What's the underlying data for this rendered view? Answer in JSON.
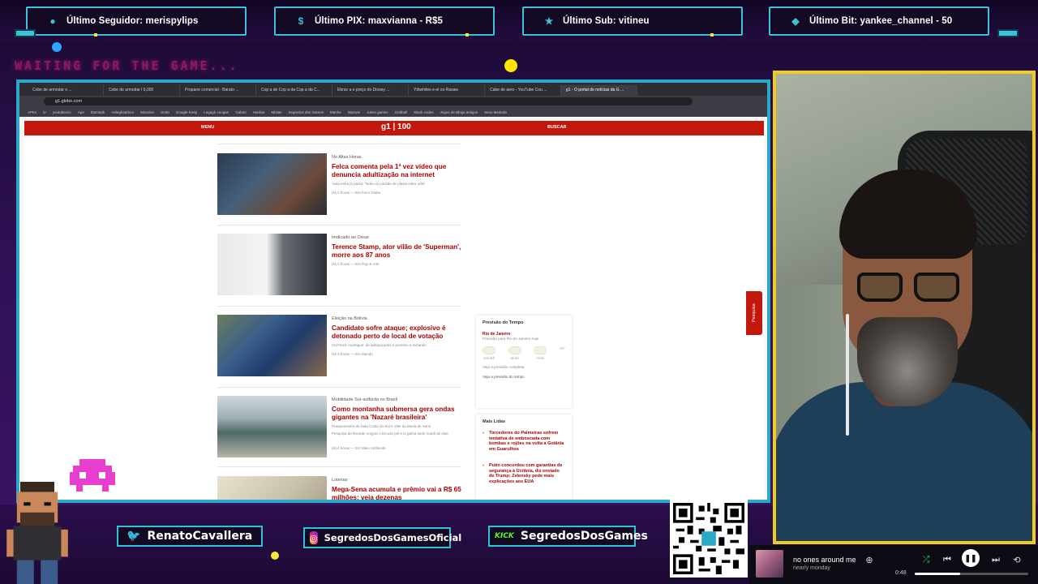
{
  "alerts": [
    {
      "icon": "user-icon",
      "text": "Último Seguidor: merispylips"
    },
    {
      "icon": "dollar-icon",
      "text": "Último PIX: maxvianna - R$5"
    },
    {
      "icon": "star-icon",
      "text": "Último Sub: vitineu"
    },
    {
      "icon": "diamond-icon",
      "text": "Último Bit: yankee_channel - 50"
    }
  ],
  "overlay": {
    "waiting_text": "WAITING FOR THE GAME..."
  },
  "browser": {
    "tabs": [
      "Cobe de armodar o ...",
      "Cobe de armodar l 5,000",
      "Propane comercial - Barato ...",
      "Cop a de Cop a da Cop a da C...",
      "Ebrav a e preço do Disney ...",
      "Ytbwhites e-el oo Rasaw",
      "Cabe de aero - YouTube Cou ...",
      "g1 - O portal de notícias da G ..."
    ],
    "active_tab": 7,
    "url": "g1.globo.com",
    "bookmarks": [
      "APKs",
      "tv",
      "youtubecnc",
      "Ape",
      "tttamaah",
      "Aeleghaddcro",
      "Mouvies",
      "Onde",
      "Google Keep",
      "Legagh ceogan",
      "Gaboo",
      "Hardue",
      "Mistas",
      "Segredos dos Games",
      "Manhe",
      "Mazwin",
      "Jukes games",
      "Gridball",
      "Slash codes",
      "Jogos de Blogs antigos",
      "Sexo Medede"
    ]
  },
  "g1": {
    "menu_label": "MENU",
    "logo": "g1 | 100",
    "search_label": "BUSCAR",
    "feedback_label": "Pesquisa"
  },
  "news": [
    {
      "section": "No Altas Horas",
      "headline": "Felca comenta pela 1ª vez vídeo que denuncia adultização na internet",
      "meta": [
        "'Aula estra já pasta: 'fudeo do pedida de plasia estra urbe'",
        "Há 3 horas — Em Foco Globo"
      ]
    },
    {
      "section": "Imdicado ao Oscar",
      "headline": "Terence Stamp, ator vilão de 'Superman', morre aos 87 anos",
      "meta": [
        "Há 3 horas — Em Pop & Arte"
      ]
    },
    {
      "section": "Eleição na Bolívia",
      "headline": "Candidato sofre ataque; explosivo é detonado perto de local de votação",
      "meta": [
        "Ou Ferrie mortaque: de adequiçados e puentes a evitando",
        "Há 3 horas — Em Mundo"
      ]
    },
    {
      "section": "Mobilidade Sur-sulfurda no Brasil",
      "headline": "Como montanha submersa gera ondas gigantes na 'Nazaré brasileira'",
      "meta": [
        "Praaprocentra de fada Costa do Sul e Vale da Muria de Santi",
        "Pesquisa de Recedo resgrar o Ercosn pel e le gama sede mardi de elas",
        "Há 4 horas — Em Meio Ambiente"
      ]
    },
    {
      "section": "Loterias",
      "headline": "Mega-Sena acumula e prêmio vai a R$ 65 milhões; veja dezenas",
      "meta": []
    }
  ],
  "weather": {
    "title": "Previsão do Tempo",
    "city": "Rio de Janeiro",
    "summary": "Previsão para Rio de Janeiro hoje",
    "periods": [
      "manhã",
      "tarde",
      "noite",
      "25°"
    ],
    "note": "Veja a previsão completa",
    "link": "Veja a previsão do tempo"
  },
  "mais_lidas": {
    "title": "Mais Lidas",
    "items": [
      "Torcedores do Palmeiras sofrem tentativa de emboscada com bombas e rojões na volta a Goiânia em Guarulhos",
      "Putin concordou com garantias de segurança à Ucrânia, diz enviado de Trump; Zelensky pede mais explicações aos EUA"
    ]
  },
  "socials": [
    {
      "icon": "twitter-icon",
      "logo": "🐦",
      "handle": "RenatoCavallera"
    },
    {
      "icon": "instagram-icon",
      "logo": "◎",
      "handle": "SegredosDosGamesOficial"
    },
    {
      "icon": "kick-icon",
      "logo": "KICK",
      "handle": "SegredosDosGames"
    }
  ],
  "qr": {
    "url": "livepix.gg/segredosdosgames"
  },
  "player": {
    "song": "no ones around me",
    "artist": "nearly monday",
    "elapsed": "0:48",
    "progress": 0.4
  },
  "colors": {
    "accent": "#29a9c7",
    "cam_border": "#f0cc1e",
    "g1_red": "#c4170c",
    "headline": "#a80000"
  }
}
